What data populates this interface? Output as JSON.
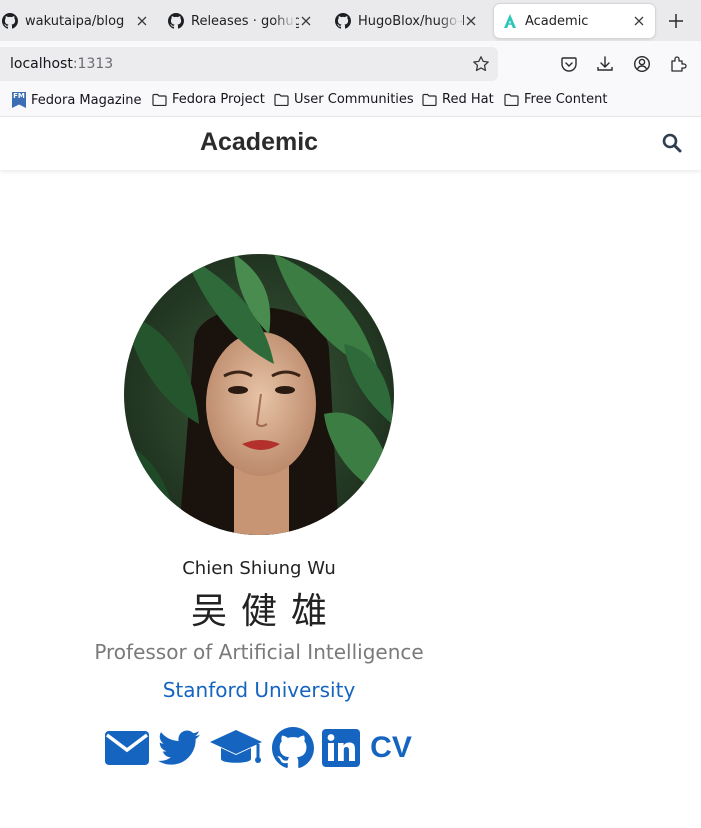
{
  "browser": {
    "tabs": [
      {
        "title": "wakutaipa/blog",
        "icon": "github-icon"
      },
      {
        "title": "Releases · gohugoio/hugo",
        "icon": "github-icon"
      },
      {
        "title": "HugoBlox/hugo-blox-builder",
        "icon": "github-icon"
      },
      {
        "title": "Academic",
        "icon": "academic-favicon-icon",
        "active": true
      }
    ],
    "url_host": "localhost",
    "url_port": ":1313",
    "bookmarks": [
      {
        "label": "Fedora Magazine",
        "icon": "fedora-magazine-icon"
      },
      {
        "label": "Fedora Project",
        "icon": "folder-icon"
      },
      {
        "label": "User Communities",
        "icon": "folder-icon"
      },
      {
        "label": "Red Hat",
        "icon": "folder-icon"
      },
      {
        "label": "Free Content",
        "icon": "folder-icon"
      }
    ],
    "fm_badge": "FM"
  },
  "site": {
    "brand": "Academic",
    "accent": "#1565c0"
  },
  "profile": {
    "name": "Chien Shiung Wu",
    "name_cn": "吴健雄",
    "role": "Professor of Artificial Intelligence",
    "organization": "Stanford University",
    "social": [
      {
        "icon": "envelope-icon"
      },
      {
        "icon": "twitter-icon"
      },
      {
        "icon": "graduation-cap-icon"
      },
      {
        "icon": "github-icon"
      },
      {
        "icon": "linkedin-icon"
      },
      {
        "label": "CV"
      }
    ]
  }
}
